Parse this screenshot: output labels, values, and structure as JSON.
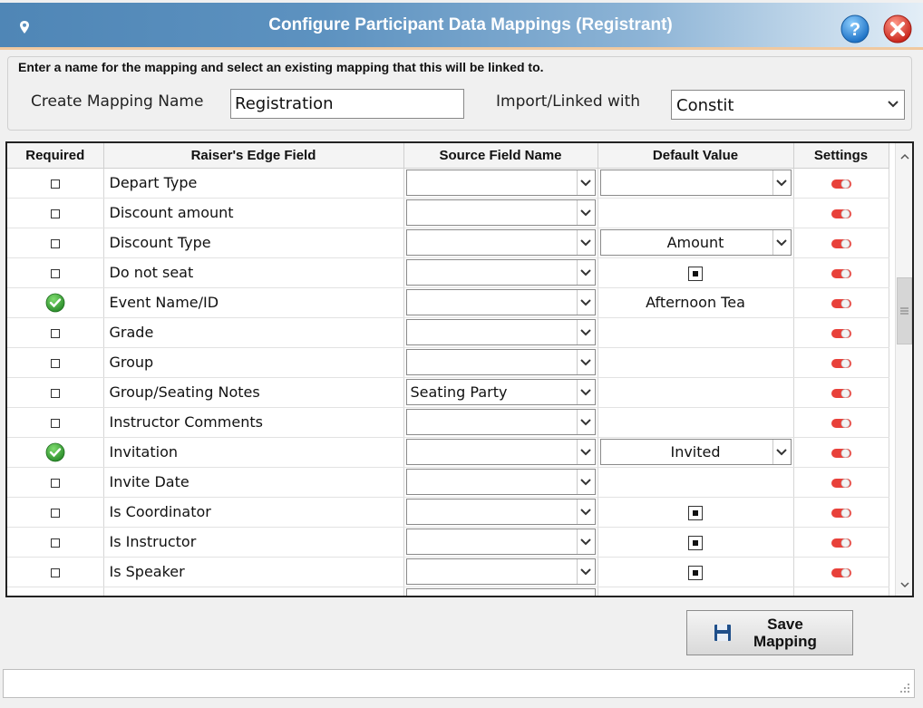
{
  "window": {
    "title": "Configure Participant Data Mappings (Registrant)"
  },
  "mapping": {
    "instruction": "Enter a name for the mapping and select an existing mapping that this will be linked to.",
    "name_label": "Create Mapping Name",
    "name_value": "Registration",
    "linked_label": "Import/Linked with",
    "linked_value": "Constit"
  },
  "grid": {
    "headers": {
      "required": "Required",
      "field": "Raiser's Edge Field",
      "source": "Source Field Name",
      "default": "Default Value",
      "settings": "Settings"
    },
    "rows": [
      {
        "required": false,
        "field": "Depart Type",
        "source": "",
        "default_type": "dropdown",
        "default": ""
      },
      {
        "required": false,
        "field": "Discount amount",
        "source": "",
        "default_type": "none",
        "default": ""
      },
      {
        "required": false,
        "field": "Discount Type",
        "source": "",
        "default_type": "dropdown",
        "default": "Amount"
      },
      {
        "required": false,
        "field": "Do not seat",
        "source": "",
        "default_type": "checkbox",
        "default": ""
      },
      {
        "required": true,
        "field": "Event Name/ID",
        "source": "",
        "default_type": "text",
        "default": "Afternoon Tea"
      },
      {
        "required": false,
        "field": "Grade",
        "source": "",
        "default_type": "none",
        "default": ""
      },
      {
        "required": false,
        "field": "Group",
        "source": "",
        "default_type": "none",
        "default": ""
      },
      {
        "required": false,
        "field": "Group/Seating Notes",
        "source": "Seating Party",
        "default_type": "none",
        "default": ""
      },
      {
        "required": false,
        "field": "Instructor Comments",
        "source": "",
        "default_type": "none",
        "default": ""
      },
      {
        "required": true,
        "field": "Invitation",
        "source": "",
        "default_type": "dropdown",
        "default": "Invited"
      },
      {
        "required": false,
        "field": "Invite Date",
        "source": "",
        "default_type": "none",
        "default": ""
      },
      {
        "required": false,
        "field": "Is Coordinator",
        "source": "",
        "default_type": "checkbox",
        "default": ""
      },
      {
        "required": false,
        "field": "Is Instructor",
        "source": "",
        "default_type": "checkbox",
        "default": ""
      },
      {
        "required": false,
        "field": "Is Speaker",
        "source": "",
        "default_type": "checkbox",
        "default": ""
      }
    ]
  },
  "actions": {
    "save_line1": "Save",
    "save_line2": "Mapping"
  },
  "colors": {
    "title_bar": "#4f86b6",
    "toggle_red": "#e8413a",
    "required_green": "#3aa335"
  }
}
